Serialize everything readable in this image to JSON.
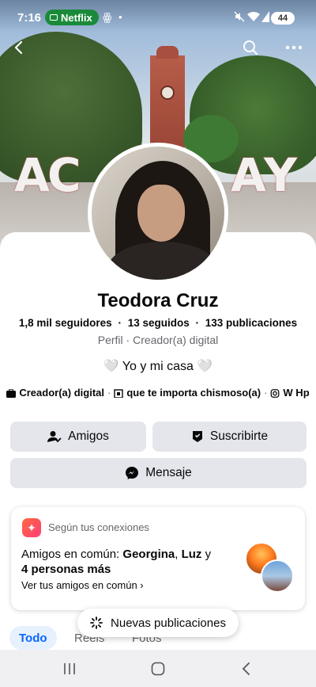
{
  "status_bar": {
    "time": "7:16",
    "app_pill": "Netflix",
    "battery": "44"
  },
  "profile": {
    "name": "Teodora Cruz",
    "followers": "1,8 mil seguidores",
    "following": "13 seguidos",
    "posts": "133 publicaciones",
    "category": "Perfil · Creador(a) digital",
    "bio": "🤍 Yo y mi casa 🤍",
    "details": {
      "creator": "Creador(a) digital",
      "workplace": "que te importa chismoso(a)",
      "instagram": "W Hp"
    }
  },
  "actions": {
    "friends": "Amigos",
    "subscribe": "Suscribirte",
    "message": "Mensaje"
  },
  "connections": {
    "title": "Según tus conexiones",
    "mutual_prefix": "Amigos en común: ",
    "name1": "Georgina",
    "sep1": ", ",
    "name2": "Luz",
    "tail": " y",
    "more": "4 personas más",
    "link": "Ver tus amigos en común ›"
  },
  "floating": {
    "label": "Nuevas publicaciones"
  },
  "tabs": [
    "Todo",
    "Reels",
    "Fotos"
  ],
  "colors": {
    "accent": "#0866ff",
    "button_bg": "#e4e6eb",
    "secondary_text": "#65676b"
  }
}
